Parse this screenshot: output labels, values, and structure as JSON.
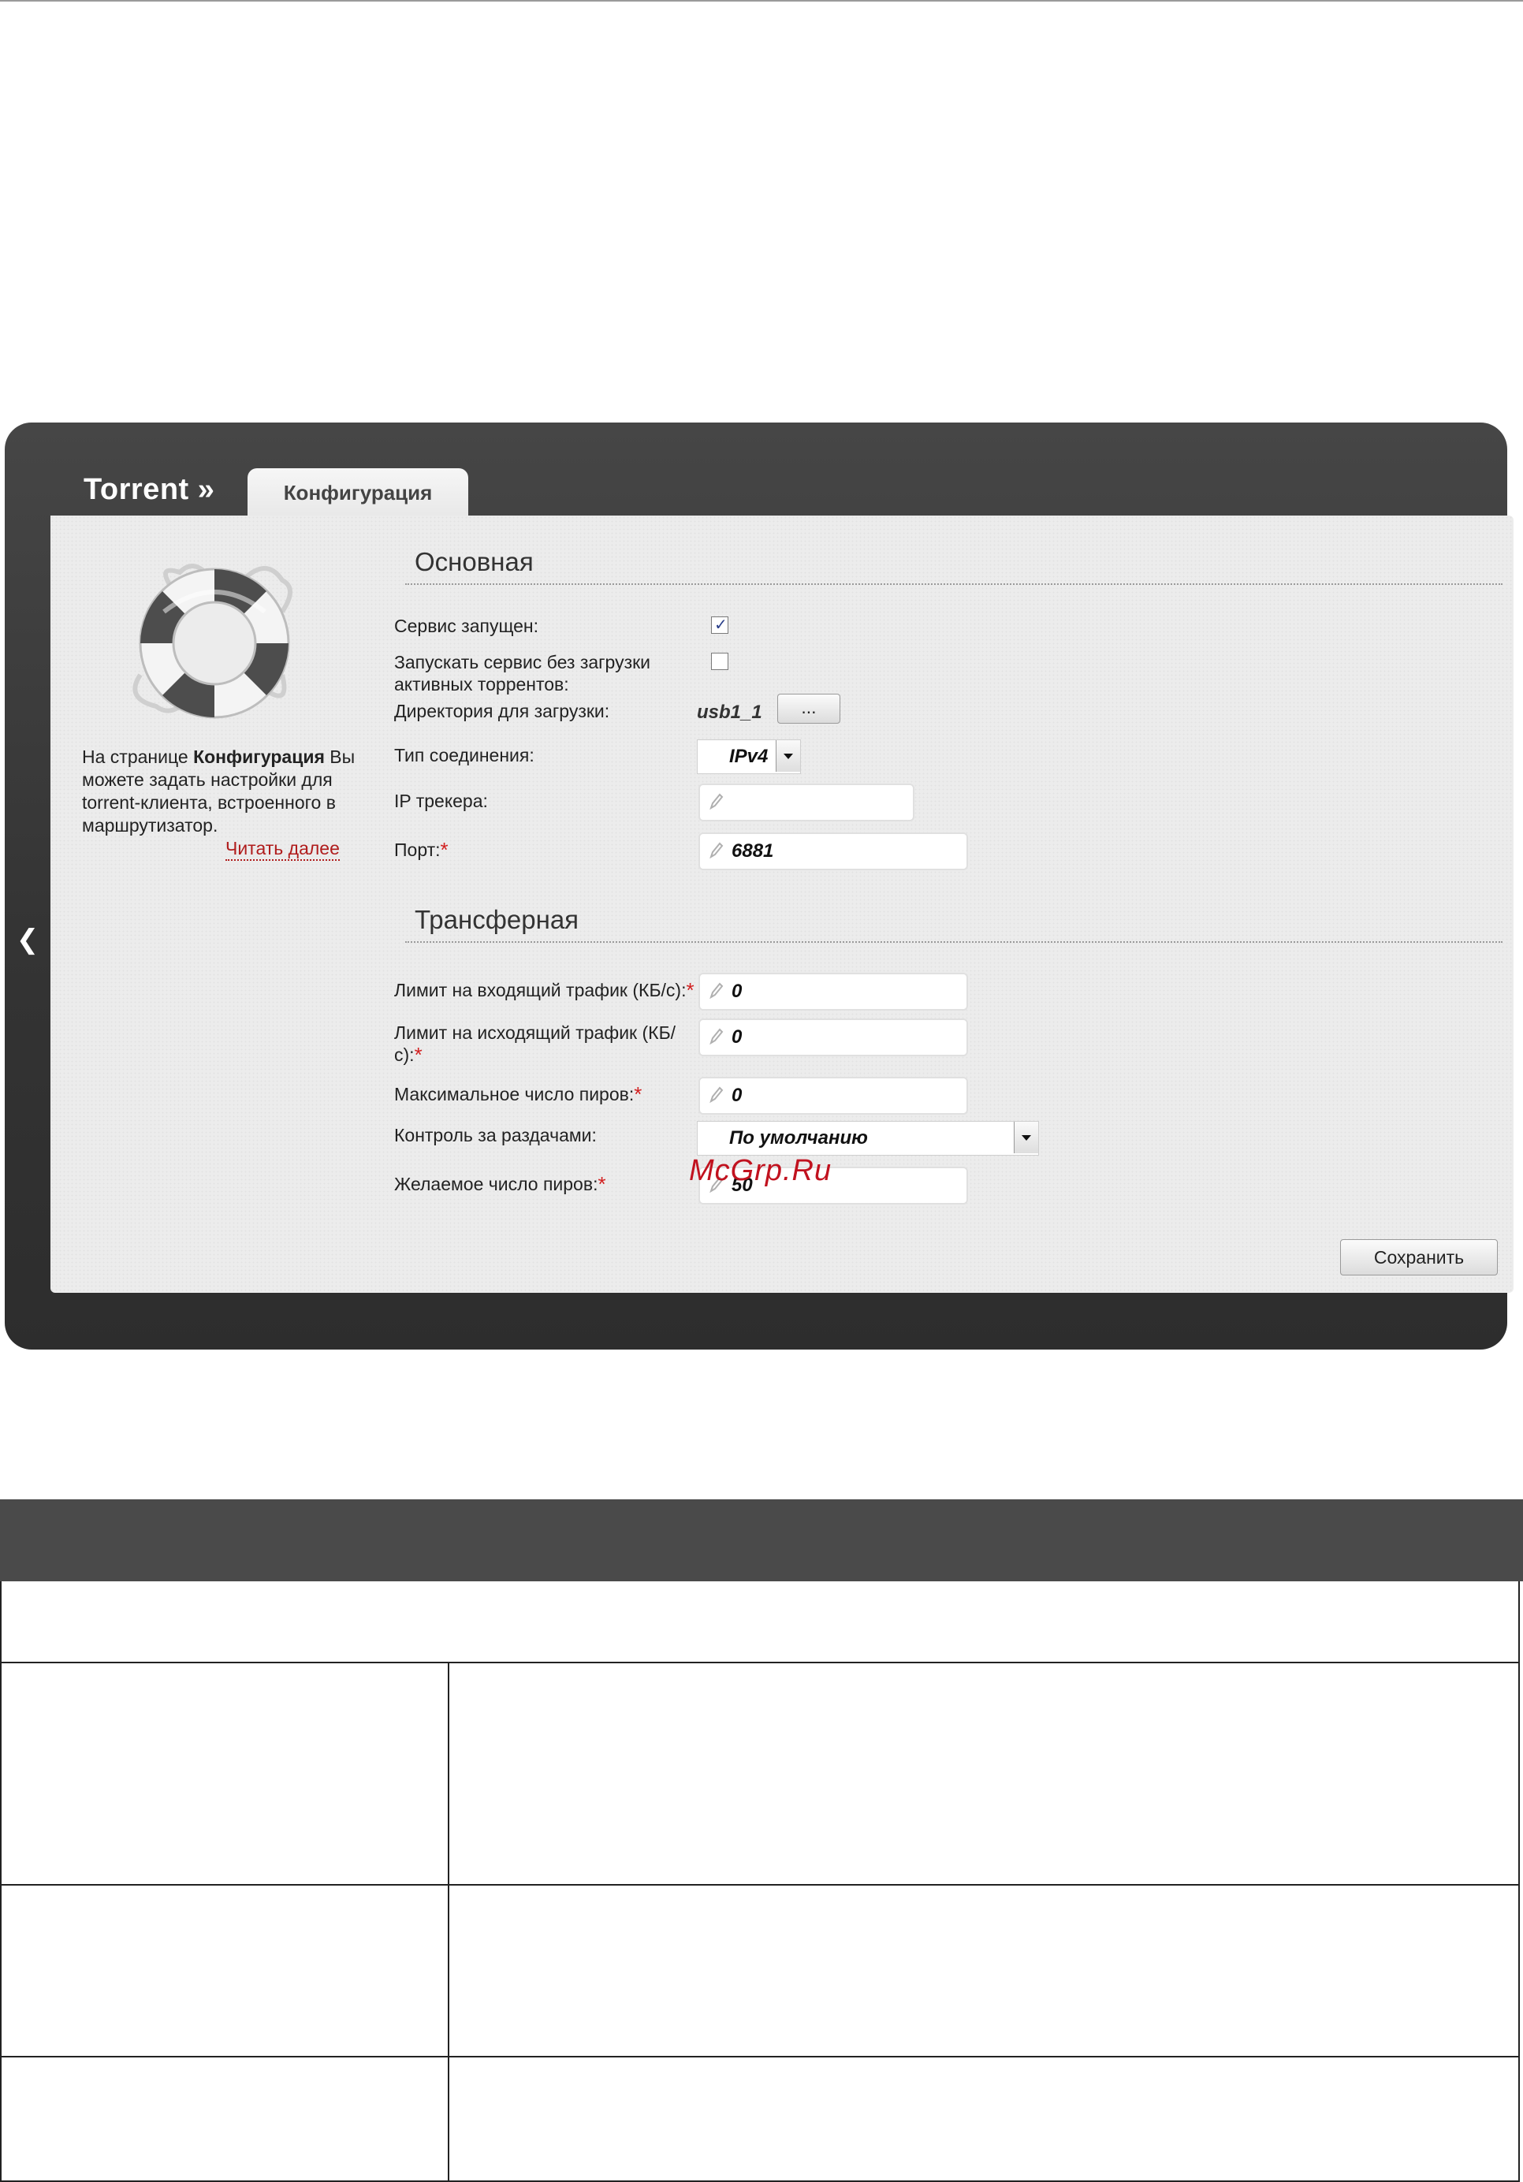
{
  "brand": "Torrent »",
  "tab": "Конфигурация",
  "help": {
    "before": "На странице ",
    "bold": "Конфигурация",
    "after": " Вы можете задать настройки для torrent-клиента, встроенного в маршрутизатор.",
    "read_more": "Читать далее"
  },
  "sections": {
    "basic": "Основная",
    "transfer": "Трансферная"
  },
  "basic": {
    "service_running": {
      "label": "Сервис запущен:",
      "checked": true
    },
    "start_without_torrents": {
      "label": "Запускать сервис без загрузки активных торрентов:",
      "checked": false
    },
    "download_dir": {
      "label": "Директория для загрузки:",
      "value": "usb1_1",
      "button": "..."
    },
    "connection_type": {
      "label": "Тип соединения:",
      "value": "IPv4"
    },
    "tracker_ip": {
      "label": "IP трекера:",
      "value": ""
    },
    "port": {
      "label": "Порт:",
      "value": "6881"
    }
  },
  "transfer": {
    "in_limit": {
      "label": "Лимит на входящий трафик (КБ/с):",
      "value": "0"
    },
    "out_limit": {
      "label": "Лимит на исходящий трафик (КБ/с):",
      "value": "0"
    },
    "max_peers": {
      "label": "Максимальное число пиров:",
      "value": "0"
    },
    "seed_control": {
      "label": "Контроль за раздачами:",
      "value": "По умолчанию"
    },
    "desired_peers": {
      "label": "Желаемое число пиров:",
      "value": "50"
    }
  },
  "required_mark": "*",
  "save_button": "Сохранить",
  "watermark": "McGrp.Ru"
}
